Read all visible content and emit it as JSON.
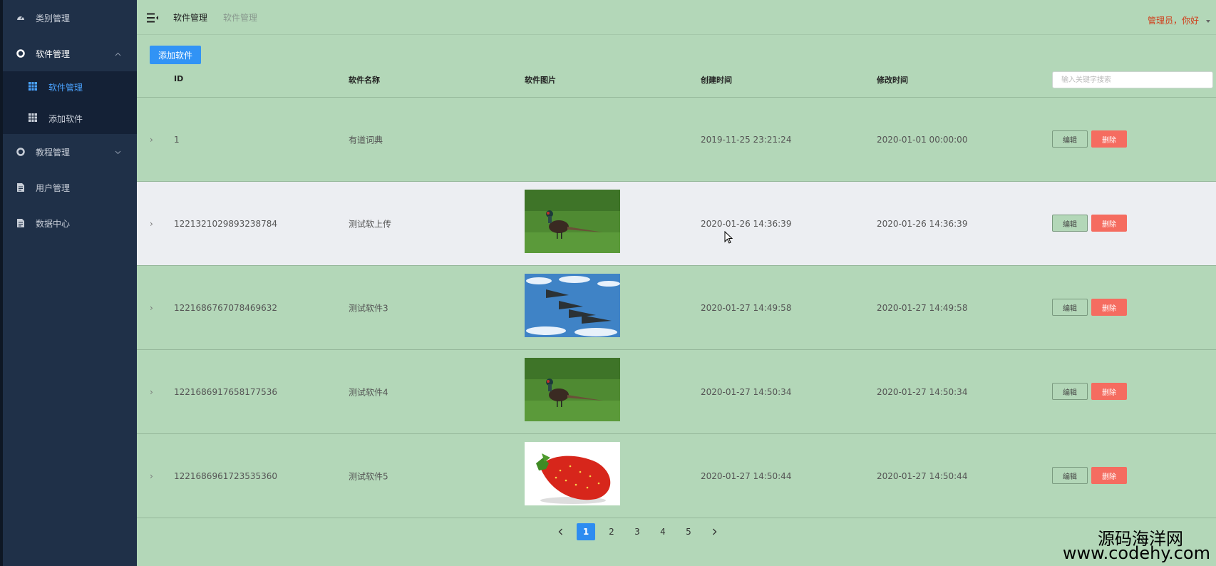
{
  "sidebar": {
    "items": [
      {
        "label": "类别管理",
        "icon": "dashboard-icon"
      },
      {
        "label": "软件管理",
        "icon": "circle-icon",
        "expanded": true,
        "children": [
          {
            "label": "软件管理",
            "icon": "grid-icon",
            "active": true
          },
          {
            "label": "添加软件",
            "icon": "grid-icon"
          }
        ]
      },
      {
        "label": "教程管理",
        "icon": "circle-icon"
      },
      {
        "label": "用户管理",
        "icon": "file-icon"
      },
      {
        "label": "数据中心",
        "icon": "file-icon"
      }
    ]
  },
  "header": {
    "breadcrumb": [
      "软件管理",
      "软件管理"
    ],
    "greeting": "管理员，你好"
  },
  "toolbar": {
    "add_label": "添加软件"
  },
  "table": {
    "columns": [
      "ID",
      "软件名称",
      "软件图片",
      "创建时间",
      "修改时间"
    ],
    "search_placeholder": "输入关键字搜索",
    "edit_label": "编辑",
    "delete_label": "删除",
    "rows": [
      {
        "id": "1",
        "name": "有道词典",
        "image": "",
        "created": "2019-11-25 23:21:24",
        "modified": "2020-01-01 00:00:00"
      },
      {
        "id": "1221321029893238784",
        "name": "测试软上传",
        "image": "pheasant",
        "created": "2020-01-26 14:36:39",
        "modified": "2020-01-26 14:36:39",
        "highlighted": true
      },
      {
        "id": "1221686767078469632",
        "name": "测试软件3",
        "image": "jets",
        "created": "2020-01-27 14:49:58",
        "modified": "2020-01-27 14:49:58"
      },
      {
        "id": "1221686917658177536",
        "name": "测试软件4",
        "image": "pheasant",
        "created": "2020-01-27 14:50:34",
        "modified": "2020-01-27 14:50:34"
      },
      {
        "id": "1221686961723535360",
        "name": "测试软件5",
        "image": "strawberry",
        "created": "2020-01-27 14:50:44",
        "modified": "2020-01-27 14:50:44"
      }
    ]
  },
  "pagination": {
    "pages": [
      "1",
      "2",
      "3",
      "4",
      "5"
    ],
    "current": "1"
  },
  "watermark": {
    "line1": "源码海洋网",
    "line2": "www.codehy.com"
  },
  "colors": {
    "sidebar": "#1f3048",
    "content": "#b3d7b8",
    "primary": "#3193f5",
    "danger": "#f56c60",
    "greeting": "#d13b18"
  }
}
